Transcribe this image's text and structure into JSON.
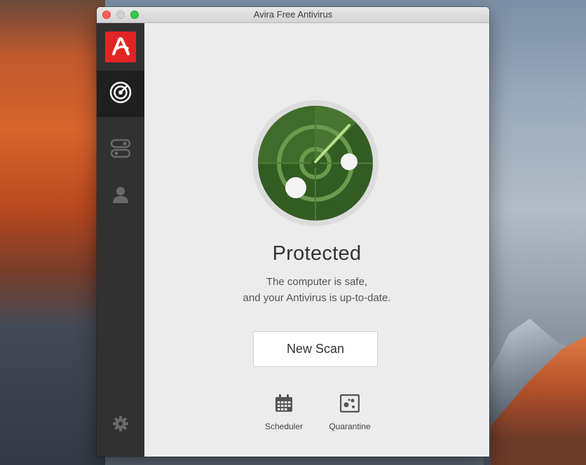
{
  "window": {
    "title": "Avira Free Antivirus"
  },
  "sidebar": {
    "items": [
      {
        "name": "radar",
        "icon": "radar-icon",
        "active": true
      },
      {
        "name": "toggles",
        "icon": "toggles-icon",
        "active": false
      },
      {
        "name": "account",
        "icon": "user-icon",
        "active": false
      },
      {
        "name": "settings",
        "icon": "gear-icon",
        "active": false
      }
    ]
  },
  "main": {
    "status_title": "Protected",
    "status_line_1": "The computer is safe,",
    "status_line_2": "and your Antivirus is up-to-date.",
    "scan_button_label": "New Scan",
    "tools": [
      {
        "label": "Scheduler",
        "icon": "calendar-icon"
      },
      {
        "label": "Quarantine",
        "icon": "quarantine-icon"
      }
    ]
  },
  "colors": {
    "brand_red": "#e32424",
    "sidebar_bg": "#313131",
    "radar_green": "#3f6b2b",
    "radar_light": "#6b9a4f"
  }
}
